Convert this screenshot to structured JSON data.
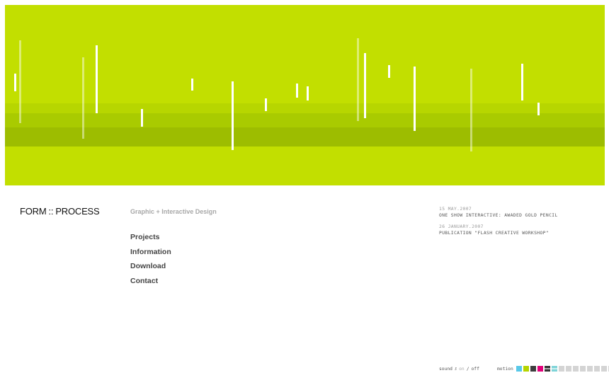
{
  "hero": {
    "colors": {
      "background": "#c2df00",
      "lines": "#ffffff"
    }
  },
  "logo": {
    "left": "FORM",
    "separator": "::",
    "right": "PROCESS"
  },
  "tagline": "Graphic + Interactive Design",
  "nav": {
    "items": [
      "Projects",
      "Information",
      "Download",
      "Contact"
    ]
  },
  "news": [
    {
      "date": "15 may.2007",
      "text": "one show interactive: awaded gold pencil"
    },
    {
      "date": "26 january.2007",
      "text": "publication \"flash creative workshop\""
    }
  ],
  "footer": {
    "sound": {
      "label": "sound",
      "on": "on",
      "slash": "/",
      "off": "off",
      "icon": "speaker-icon"
    },
    "motion": {
      "label": "motion",
      "swatches": [
        "#58c8e8",
        "#b6d400",
        "#3d3d3d",
        "#e2007a",
        "#333333",
        "#7fd4d8",
        "#d4d4d4",
        "#d4d4d4",
        "#d4d4d4",
        "#d4d4d4",
        "#d4d4d4",
        "#d4d4d4",
        "#d4d4d4",
        "#d4d4d4"
      ]
    }
  }
}
